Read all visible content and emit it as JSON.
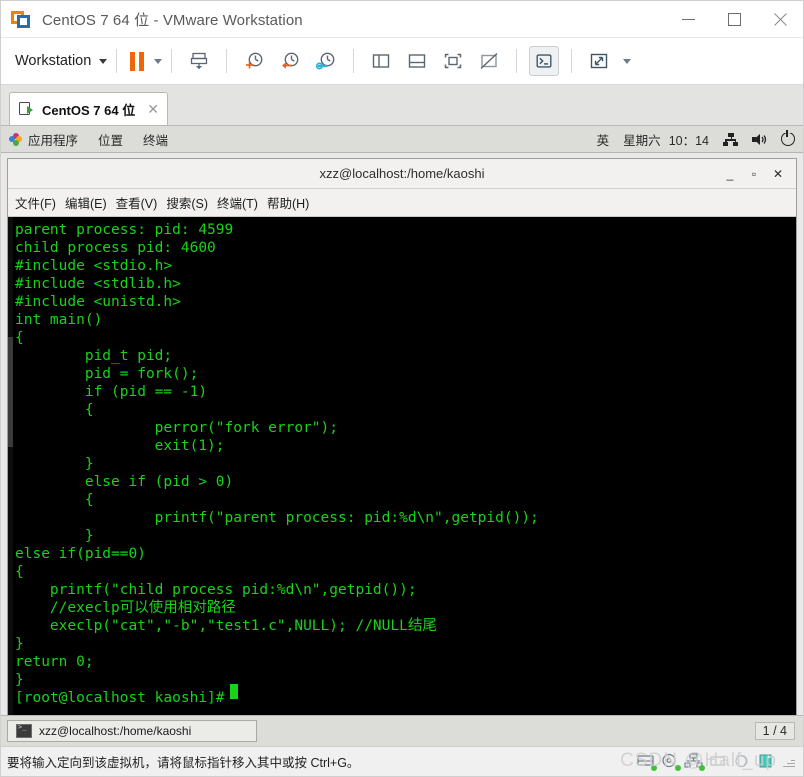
{
  "window": {
    "title": "CentOS 7 64 位 - VMware Workstation",
    "controls": {
      "minimize": "—",
      "maximize": "□",
      "close": "✕"
    }
  },
  "toolbar": {
    "workstation_menu": "Workstation",
    "buttons": [
      {
        "name": "suspend",
        "label": "Suspend"
      },
      {
        "name": "snapshot-take",
        "label": "Take snapshot"
      },
      {
        "name": "snapshot-revert",
        "label": "Revert snapshot"
      },
      {
        "name": "snapshot-manager",
        "label": "Snapshot manager"
      },
      {
        "name": "show-left-pane",
        "label": "Show library"
      },
      {
        "name": "show-bottom-pane",
        "label": "Show thumbnails"
      },
      {
        "name": "fullscreen",
        "label": "Enter full screen"
      },
      {
        "name": "unity",
        "label": "Unity mode"
      },
      {
        "name": "console-view",
        "label": "Console view"
      },
      {
        "name": "stretch",
        "label": "Stretch guest"
      }
    ]
  },
  "vm_tab": {
    "label": "CentOS 7 64 位",
    "close": "✕"
  },
  "gnome_top": {
    "applications": "应用程序",
    "places": "位置",
    "terminal": "终端",
    "input_method": "英",
    "day": "星期六",
    "time": "10：14"
  },
  "terminal_window": {
    "title": "xzz@localhost:/home/kaoshi",
    "controls": {
      "minimize": "_",
      "maximize": "▫",
      "close": "✕"
    },
    "menus": [
      "文件(F)",
      "编辑(E)",
      "查看(V)",
      "搜索(S)",
      "终端(T)",
      "帮助(H)"
    ],
    "content": "parent process: pid: 4599\nchild process pid: 4600\n#include <stdio.h>\n#include <stdlib.h>\n#include <unistd.h>\nint main()\n{\n        pid_t pid;\n        pid = fork();\n        if (pid == -1)\n        {\n                perror(\"fork error\");\n                exit(1);\n        }\n        else if (pid > 0)\n        {\n                printf(\"parent process: pid:%d\\n\",getpid());\n        }\nelse if(pid==0)\n{\n    printf(\"child process pid:%d\\n\",getpid());\n    //execlp可以使用相对路径\n    execlp(\"cat\",\"-b\",\"test1.c\",NULL); //NULL结尾\n}\nreturn 0;\n}\n[root@localhost kaoshi]# ",
    "prompt": "[root@localhost kaoshi]#"
  },
  "gnome_taskbar": {
    "window_item": "xzz@localhost:/home/kaoshi",
    "workspace": "1 / 4"
  },
  "status_bar": {
    "message": "要将输入定向到该虚拟机，请将鼠标指针移入其中或按 Ctrl+G。",
    "watermark": "CSDN @Half_up"
  },
  "colors": {
    "vmware_orange": "#f0650a",
    "terminal_green": "#18d318",
    "terminal_bg": "#000000",
    "chrome_gray": "#dcdcd8"
  }
}
